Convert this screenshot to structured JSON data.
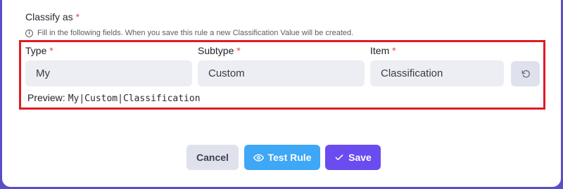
{
  "classify": {
    "title": "Classify as",
    "required_mark": "*",
    "hint_icon": "info-icon",
    "hint": "Fill in the following fields. When you save this rule a new Classification Value will be created."
  },
  "fields": {
    "type": {
      "label": "Type",
      "value": "My"
    },
    "subtype": {
      "label": "Subtype",
      "value": "Custom"
    },
    "item": {
      "label": "Item",
      "value": "Classification"
    }
  },
  "reset_icon": "undo-icon",
  "preview": {
    "label": "Preview:",
    "value": "My|Custom|Classification"
  },
  "buttons": {
    "cancel": "Cancel",
    "test_rule": "Test Rule",
    "test_rule_icon": "eye-icon",
    "save": "Save",
    "save_icon": "check-icon"
  },
  "colors": {
    "required": "#e5484d",
    "highlight_border": "#e01b24",
    "test_button": "#3ea7f6",
    "save_button": "#6a4cf0",
    "cancel_button": "#dfe1ec"
  }
}
